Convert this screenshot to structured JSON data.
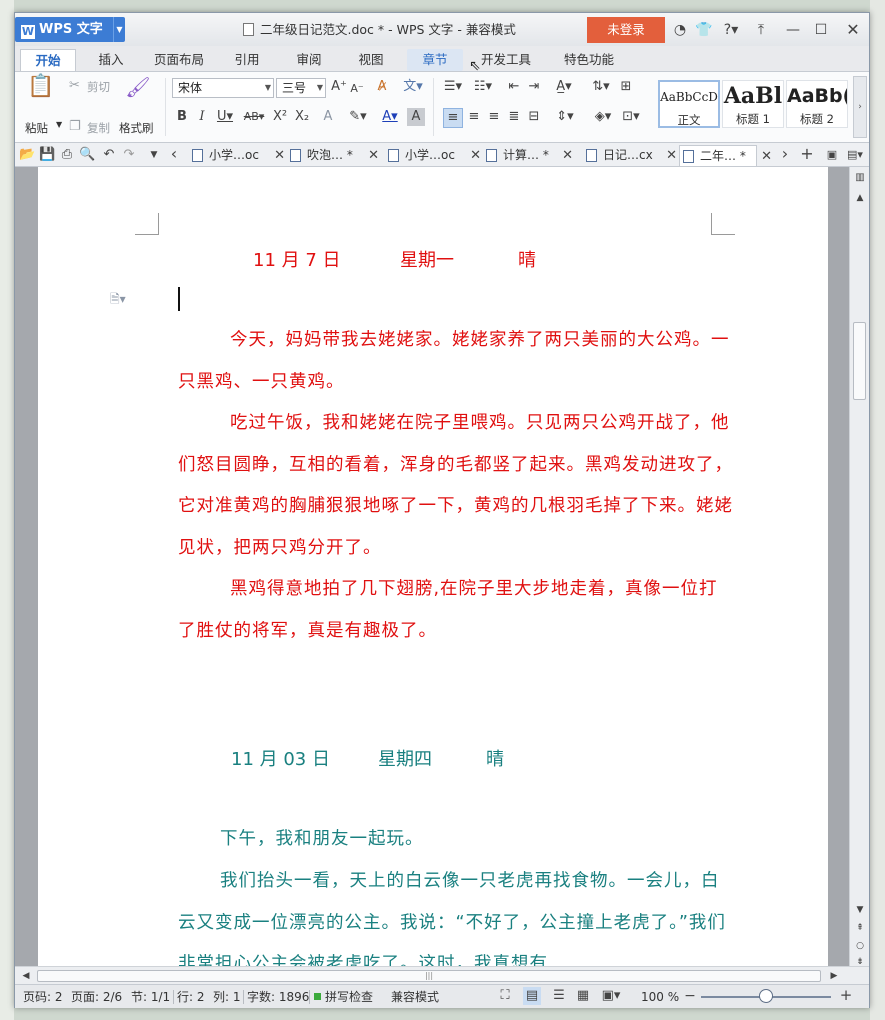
{
  "app": {
    "name": "WPS 文字",
    "title": "二年级日记范文.doc * - WPS 文字 - 兼容模式",
    "login_label": "未登录",
    "title_icons": [
      "feedback-icon",
      "skin-icon",
      "help-icon",
      "collapse-ribbon-icon",
      "minimize-icon",
      "maximize-icon",
      "close-icon"
    ]
  },
  "menu_tabs": [
    "开始",
    "插入",
    "页面布局",
    "引用",
    "审阅",
    "视图",
    "章节",
    "开发工具",
    "特色功能"
  ],
  "ribbon": {
    "paste": "粘贴",
    "cut": "剪切",
    "copy": "复制",
    "format_painter": "格式刷",
    "font_name": "宋体",
    "font_size": "三号",
    "styles": [
      {
        "preview": "AaBbCcD",
        "name": "正文"
      },
      {
        "preview": "AaBl",
        "name": "标题 1"
      },
      {
        "preview": "AaBb(",
        "name": "标题 2"
      }
    ]
  },
  "doc_tabs": [
    {
      "label": "小学…oc",
      "active": false
    },
    {
      "label": "吹泡… *",
      "active": false
    },
    {
      "label": "小学…oc",
      "active": false
    },
    {
      "label": "计算… *",
      "active": false
    },
    {
      "label": "日记…cx",
      "active": false
    },
    {
      "label": "二年… *",
      "active": true
    }
  ],
  "document": {
    "entry1": {
      "date": "11 月 7 日",
      "weekday": "星期一",
      "weather": "晴",
      "paragraphs": [
        "今天，妈妈带我去姥姥家。姥姥家养了两只美丽的大公鸡。一只黑鸡、一只黄鸡。",
        "吃过午饭，我和姥姥在院子里喂鸡。只见两只公鸡开战了，他们怒目圆睁，互相的看着，浑身的毛都竖了起来。黑鸡发动进攻了，它对准黄鸡的胸脯狠狠地啄了一下，黄鸡的几根羽毛掉了下来。姥姥见状，把两只鸡分开了。",
        "黑鸡得意地拍了几下翅膀,在院子里大步地走着，真像一位打了胜仗的将军，真是有趣极了。"
      ]
    },
    "entry2": {
      "date": "11 月 03 日",
      "weekday": "星期四",
      "weather": "晴",
      "paragraphs": [
        "下午，我和朋友一起玩。",
        "我们抬头一看，天上的白云像一只老虎再找食物。一会儿，白云又变成一位漂亮的公主。我说：“不好了，公主撞上老虎了。”我们非常担心公主会被老虎吃了。这时，我真想有"
      ]
    }
  },
  "status": {
    "page_code": "页码: 2",
    "pages": "页面: 2/6",
    "section": "节: 1/1",
    "row": "行: 2",
    "column": "列: 1",
    "word_count": "字数: 1896",
    "spell_check": "拼写检查",
    "mode": "兼容模式",
    "zoom": "100 %",
    "zoom_fraction": 0.5
  }
}
